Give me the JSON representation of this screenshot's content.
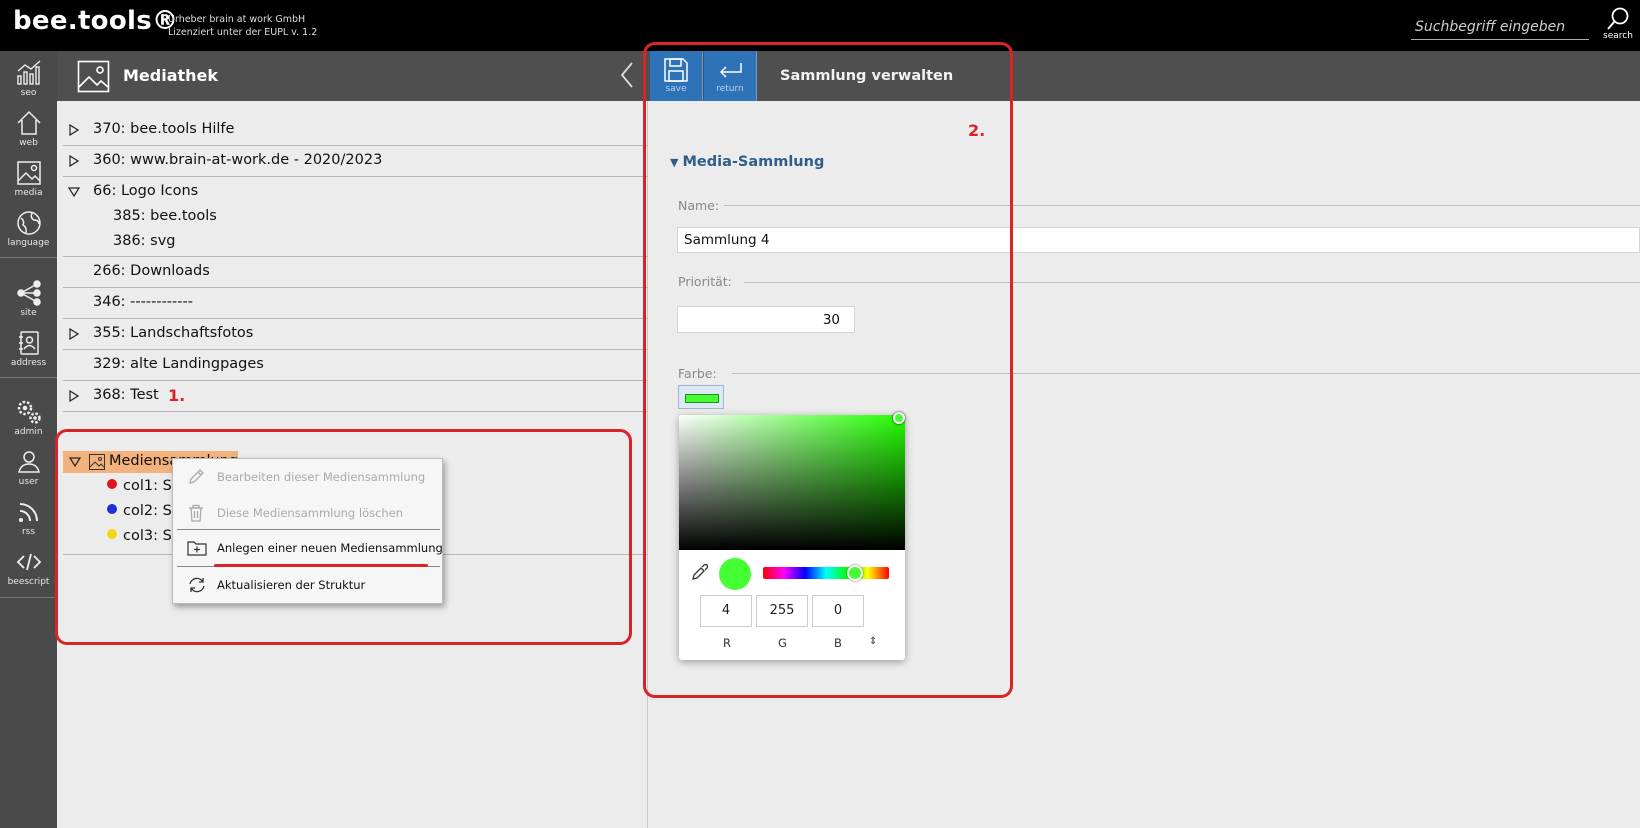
{
  "app": {
    "logo": "bee.tools®",
    "sub_line1": "Urheber brain at work GmbH",
    "sub_line2": "Lizenziert unter der EUPL v. 1.2"
  },
  "search": {
    "placeholder": "Suchbegriff eingeben",
    "button_label": "search"
  },
  "sidebar": {
    "items": [
      {
        "label": "seo",
        "icon": "chart-icon"
      },
      {
        "label": "web",
        "icon": "home-icon"
      },
      {
        "label": "media",
        "icon": "image-icon"
      },
      {
        "label": "language",
        "icon": "globe-icon"
      },
      {
        "label": "site",
        "icon": "sitemap-icon"
      },
      {
        "label": "address",
        "icon": "address-book-icon"
      },
      {
        "label": "admin",
        "icon": "gears-icon"
      },
      {
        "label": "user",
        "icon": "user-icon"
      },
      {
        "label": "rss",
        "icon": "rss-icon"
      },
      {
        "label": "beescript",
        "icon": "code-icon"
      }
    ]
  },
  "mediathek": {
    "title": "Mediathek",
    "tree": [
      {
        "label": "370: bee.tools Hilfe",
        "expandable": true
      },
      {
        "label": "360: www.brain-at-work.de - 2020/2023",
        "expandable": true
      },
      {
        "label": "66: Logo Icons",
        "expanded": true,
        "children": [
          "385: bee.tools",
          "386: svg"
        ]
      },
      {
        "label": "266: Downloads",
        "expandable": false
      },
      {
        "label": "346: ------------",
        "expandable": false
      },
      {
        "label": "355: Landschaftsfotos",
        "expandable": true
      },
      {
        "label": "329: alte Landingpages",
        "expandable": false
      },
      {
        "label": "368: Test",
        "expandable": true
      }
    ],
    "collection": {
      "label": "Mediensammlung",
      "items": [
        {
          "label": "col1: Sa",
          "color": "#e0141b"
        },
        {
          "label": "col2: Sa",
          "color": "#1a2fd4"
        },
        {
          "label": "col3: Sa",
          "color": "#f5d80f"
        }
      ]
    }
  },
  "context_menu": {
    "items": [
      {
        "label": "Bearbeiten dieser Mediensammlung",
        "icon": "pencil-icon",
        "disabled": true
      },
      {
        "label": "Diese Mediensammlung löschen",
        "icon": "trash-icon",
        "disabled": true
      },
      {
        "label": "Anlegen einer neuen Mediensammlung",
        "icon": "folder-plus-icon",
        "disabled": false
      },
      {
        "label": "Aktualisieren der Struktur",
        "icon": "refresh-icon",
        "disabled": false
      }
    ]
  },
  "annotations": {
    "step1": "1.",
    "step2": "2."
  },
  "editor": {
    "save_label": "save",
    "return_label": "return",
    "title": "Sammlung verwalten",
    "section": "Media-Sammlung",
    "name_label": "Name:",
    "name_value": "Sammlung 4",
    "prio_label": "Priorität:",
    "prio_value": "30",
    "color_label": "Farbe:",
    "color_value": "#44ff33"
  },
  "color_picker": {
    "r": "4",
    "g": "255",
    "b": "0",
    "r_label": "R",
    "g_label": "G",
    "b_label": "B",
    "mode_toggle": "⇕"
  }
}
